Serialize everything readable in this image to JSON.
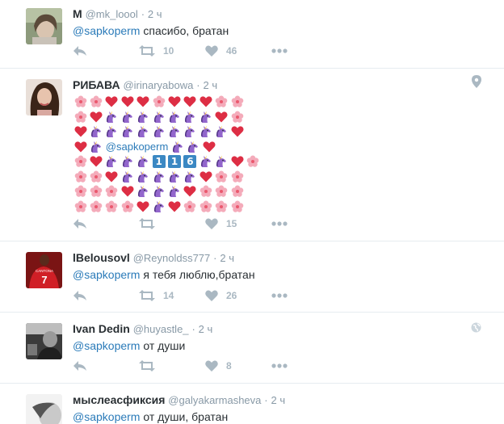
{
  "tweets": [
    {
      "fullname": "M",
      "handle": "@mk_loool",
      "dot": "·",
      "time": "2 ч",
      "mention": "@sapkoperm",
      "text": " спасибо, братан",
      "retweets": "10",
      "likes": "46"
    },
    {
      "fullname": "РИБАВА",
      "handle": "@irinaryabowa",
      "dot": "·",
      "time": "2 ч",
      "mention": "@sapkoperm",
      "keycaps": [
        "1",
        "1",
        "6"
      ],
      "retweets": "",
      "likes": "15",
      "icon": "location-pin-icon"
    },
    {
      "fullname": "lBelousovl",
      "handle": "@Reynoldss777",
      "dot": "·",
      "time": "2 ч",
      "mention": "@sapkoperm",
      "text": " я тебя люблю,братан",
      "retweets": "14",
      "likes": "26",
      "avatar_text": "CANTONA",
      "avatar_number": "7"
    },
    {
      "fullname": "Ivan Dedin",
      "handle": "@huyastle_",
      "dot": "·",
      "time": "2 ч",
      "mention": "@sapkoperm",
      "text": " от души",
      "retweets": "",
      "likes": "8",
      "icon": "globe-icon"
    },
    {
      "fullname": "мыслеасфиксия",
      "handle": "@galyakarmasheva",
      "dot": "·",
      "time": "2 ч",
      "mention": "@sapkoperm",
      "text": " от души, братан"
    }
  ],
  "colors": {
    "mention": "#2b7bb9",
    "meta": "#8899a6",
    "action": "#aab8c2",
    "divider": "#e6ecf0",
    "heart": "#dd2e44",
    "blossom": "#f4abba",
    "unicorn": "#9266cc",
    "keycap": "#3b88c3"
  },
  "emoji_grid": {
    "legend": {
      "b": "cherry-blossom",
      "h": "red-heart",
      "u": "unicorn",
      "m": "mention",
      "k": "keycap-digit"
    },
    "rows": [
      "bbhhhbhhhbb",
      "bhuuuuuuuhb",
      "huuuuuuuuuh",
      "hum",
      "bhuuukuuhb",
      "bbhuuuuuhbb",
      "bbbhuuuhbbb",
      "bbbbhuhbbbb"
    ]
  }
}
